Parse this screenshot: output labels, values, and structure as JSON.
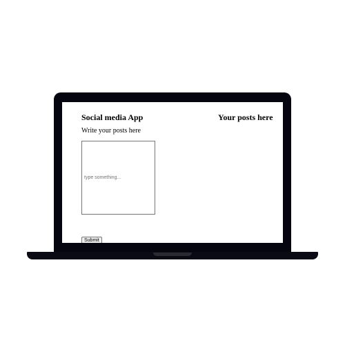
{
  "app": {
    "title": "Social media App"
  },
  "posts_panel": {
    "title": "Your posts here"
  },
  "composer": {
    "label": "Write your posts here",
    "placeholder": "type something...",
    "value": "",
    "submit_label": "Submit"
  },
  "colors": {
    "laptop_frame": "#05050f",
    "screen_background": "#ffffff"
  }
}
